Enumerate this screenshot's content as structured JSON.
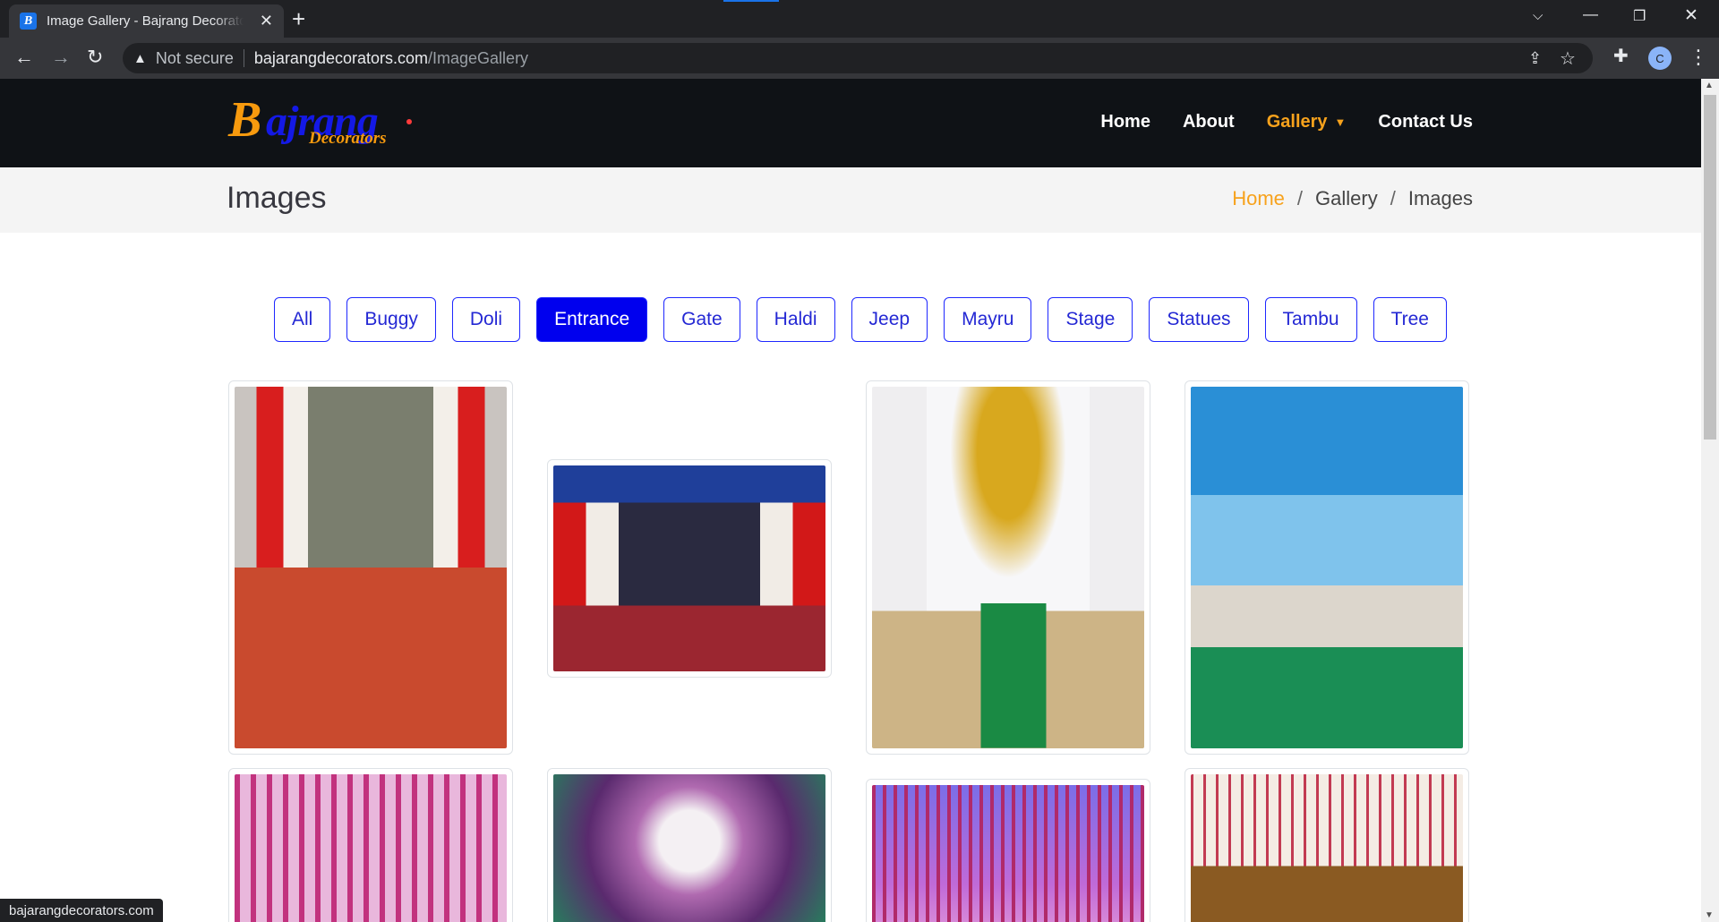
{
  "browser": {
    "tab_title": "Image Gallery - Bajrang Decorators",
    "favicon_letter": "B",
    "not_secure": "Not secure",
    "url_host": "bajarangdecorators.com",
    "url_path": "/ImageGallery",
    "profile_initial": "C",
    "status_url": "bajarangdecorators.com"
  },
  "site": {
    "logo_main": "Bajrang",
    "logo_b": "B",
    "logo_rest": "ajrang",
    "logo_sub": "Decorators",
    "nav": {
      "home": "Home",
      "about": "About",
      "gallery": "Gallery",
      "contact": "Contact Us"
    },
    "colors": {
      "header_bg": "#0f1216",
      "accent": "#f7a21c",
      "primary": "#0000ee"
    }
  },
  "page": {
    "title": "Images",
    "breadcrumb": {
      "home": "Home",
      "gallery": "Gallery",
      "current": "Images",
      "separator": "/"
    }
  },
  "filters": {
    "items": [
      "All",
      "Buggy",
      "Doli",
      "Entrance",
      "Gate",
      "Haldi",
      "Jeep",
      "Mayru",
      "Stage",
      "Statues",
      "Tambu",
      "Tree"
    ],
    "active": "Entrance"
  }
}
